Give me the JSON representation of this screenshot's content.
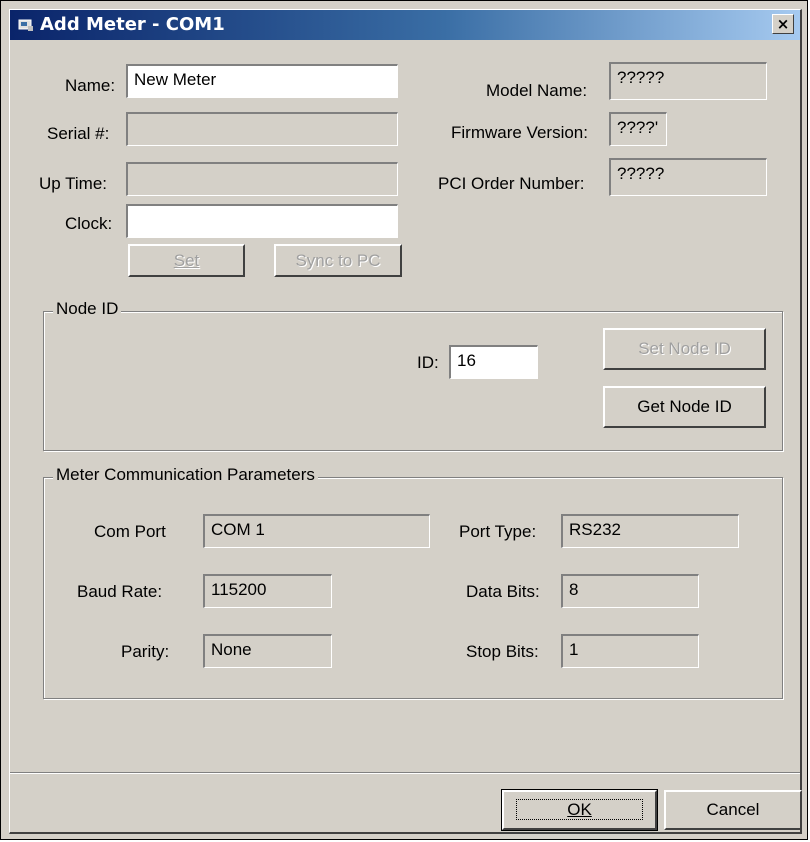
{
  "window": {
    "title": "Add Meter - COM1",
    "close_label": "×"
  },
  "meter_info": {
    "name_label": "Name:",
    "name_value": "New Meter",
    "serial_label": "Serial #:",
    "serial_value": "",
    "uptime_label": "Up Time:",
    "uptime_value": "",
    "clock_label": "Clock:",
    "clock_value": "",
    "set_label": "Set",
    "sync_label": "Sync to PC",
    "model_label": "Model Name:",
    "model_value": "?????",
    "firmware_label": "Firmware Version:",
    "firmware_value": "????'",
    "pci_label": "PCI Order Number:",
    "pci_value": "?????"
  },
  "node_id": {
    "group_title": "Node ID",
    "id_label": "ID:",
    "id_value": "16",
    "set_button": "Set Node ID",
    "get_button": "Get Node ID"
  },
  "comm_params": {
    "group_title": "Meter Communication Parameters",
    "com_port_label": "Com Port",
    "com_port_value": "COM 1",
    "baud_label": "Baud Rate:",
    "baud_value": "115200",
    "parity_label": "Parity:",
    "parity_value": "None",
    "port_type_label": "Port Type:",
    "port_type_value": "RS232",
    "data_bits_label": "Data Bits:",
    "data_bits_value": "8",
    "stop_bits_label": "Stop Bits:",
    "stop_bits_value": "1"
  },
  "footer": {
    "ok_label": "OK",
    "cancel_label": "Cancel"
  },
  "colors": {
    "face": "#d4d0c8",
    "title_start": "#0a246a",
    "title_end": "#a6caf0"
  }
}
